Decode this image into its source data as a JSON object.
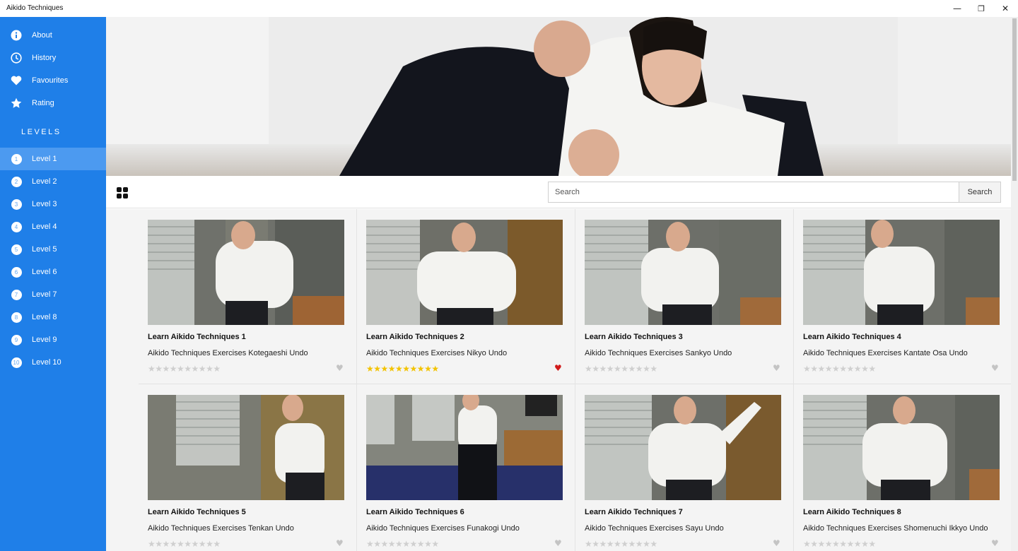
{
  "window": {
    "title": "Aikido Techniques",
    "minimize": "—",
    "restore": "❐",
    "close": "✕"
  },
  "sidebar": {
    "menu": [
      {
        "label": "About",
        "icon": "info-icon"
      },
      {
        "label": "History",
        "icon": "clock-icon"
      },
      {
        "label": "Favourites",
        "icon": "heart-icon"
      },
      {
        "label": "Rating",
        "icon": "star-icon"
      }
    ],
    "levels_heading": "LEVELS",
    "levels": [
      {
        "num": "1",
        "label": "Level 1",
        "active": true
      },
      {
        "num": "2",
        "label": "Level 2"
      },
      {
        "num": "3",
        "label": "Level 3"
      },
      {
        "num": "4",
        "label": "Level 4"
      },
      {
        "num": "5",
        "label": "Level 5"
      },
      {
        "num": "6",
        "label": "Level 6"
      },
      {
        "num": "7",
        "label": "Level 7"
      },
      {
        "num": "8",
        "label": "Level 8"
      },
      {
        "num": "9",
        "label": "Level 9"
      },
      {
        "num": "10",
        "label": "Level 10"
      }
    ]
  },
  "toolbar": {
    "search_placeholder": "Search",
    "search_button": "Search"
  },
  "videos": [
    {
      "title": "Learn Aikido Techniques 1",
      "subtitle": "Aikido Techniques Exercises Kotegaeshi Undo",
      "rating": 0,
      "favourite": false
    },
    {
      "title": "Learn Aikido Techniques 2",
      "subtitle": "Aikido Techniques Exercises Nikyo Undo",
      "rating": 10,
      "favourite": true
    },
    {
      "title": "Learn Aikido Techniques 3",
      "subtitle": "Aikido Techniques Exercises Sankyo Undo",
      "rating": 0,
      "favourite": false
    },
    {
      "title": "Learn Aikido Techniques 4",
      "subtitle": "Aikido Techniques Exercises Kantate Osa Undo",
      "rating": 0,
      "favourite": false
    },
    {
      "title": "Learn Aikido Techniques 5",
      "subtitle": "Aikido Techniques Exercises Tenkan Undo",
      "rating": 0,
      "favourite": false
    },
    {
      "title": "Learn Aikido Techniques 6",
      "subtitle": "Aikido Techniques Exercises Funakogi Undo",
      "rating": 0,
      "favourite": false
    },
    {
      "title": "Learn Aikido Techniques 7",
      "subtitle": "Aikido Techniques Exercises Sayu Undo",
      "rating": 0,
      "favourite": false
    },
    {
      "title": "Learn Aikido Techniques 8",
      "subtitle": "Aikido Techniques Exercises Shomenuchi Ikkyo Undo",
      "rating": 0,
      "favourite": false
    }
  ],
  "stars_max": 10,
  "colors": {
    "accent": "#1f7fe8",
    "star_rated": "#f3c300",
    "heart_fav": "#d11a1a"
  }
}
